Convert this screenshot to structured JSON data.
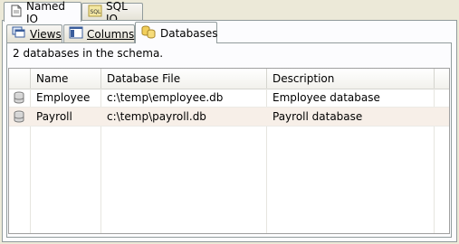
{
  "outer_tabs": [
    {
      "label": "Named IO",
      "icon": "document-icon",
      "active": true
    },
    {
      "label": "SQL IO",
      "icon": "sql-icon",
      "active": false
    }
  ],
  "inner_tabs": [
    {
      "label": "Views",
      "icon": "views-icon",
      "active": false
    },
    {
      "label": "Columns",
      "icon": "columns-icon",
      "active": false
    },
    {
      "label": "Databases",
      "icon": "databases-icon",
      "active": true
    }
  ],
  "status_text": "2 databases in the schema.",
  "table": {
    "columns": [
      "Name",
      "Database File",
      "Description"
    ],
    "rows": [
      {
        "name": "Employee",
        "file": "c:\\temp\\employee.db",
        "description": "Employee database"
      },
      {
        "name": "Payroll",
        "file": "c:\\temp\\payroll.db",
        "description": "Payroll database"
      }
    ]
  },
  "colors": {
    "selected_row": "#f7efe8",
    "panel_border": "#919b9c",
    "background": "#ece9d8"
  }
}
